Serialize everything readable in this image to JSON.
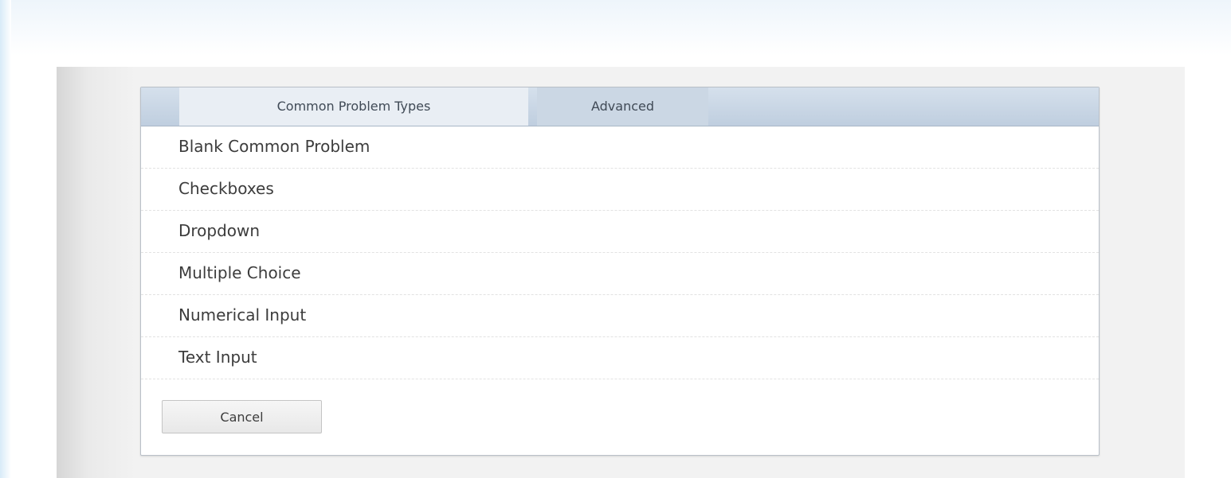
{
  "tabs": [
    {
      "label": "Common Problem Types",
      "active": true
    },
    {
      "label": "Advanced",
      "active": false
    }
  ],
  "problem_types": [
    {
      "label": "Blank Common Problem"
    },
    {
      "label": "Checkboxes"
    },
    {
      "label": "Dropdown"
    },
    {
      "label": "Multiple Choice"
    },
    {
      "label": "Numerical Input"
    },
    {
      "label": "Text Input"
    }
  ],
  "cancel_label": "Cancel",
  "colors": {
    "tab_bar": "#c7d4e3",
    "active_tab": "#e9eef4",
    "panel": "#f2f2f2",
    "text": "#3c3c3c"
  }
}
